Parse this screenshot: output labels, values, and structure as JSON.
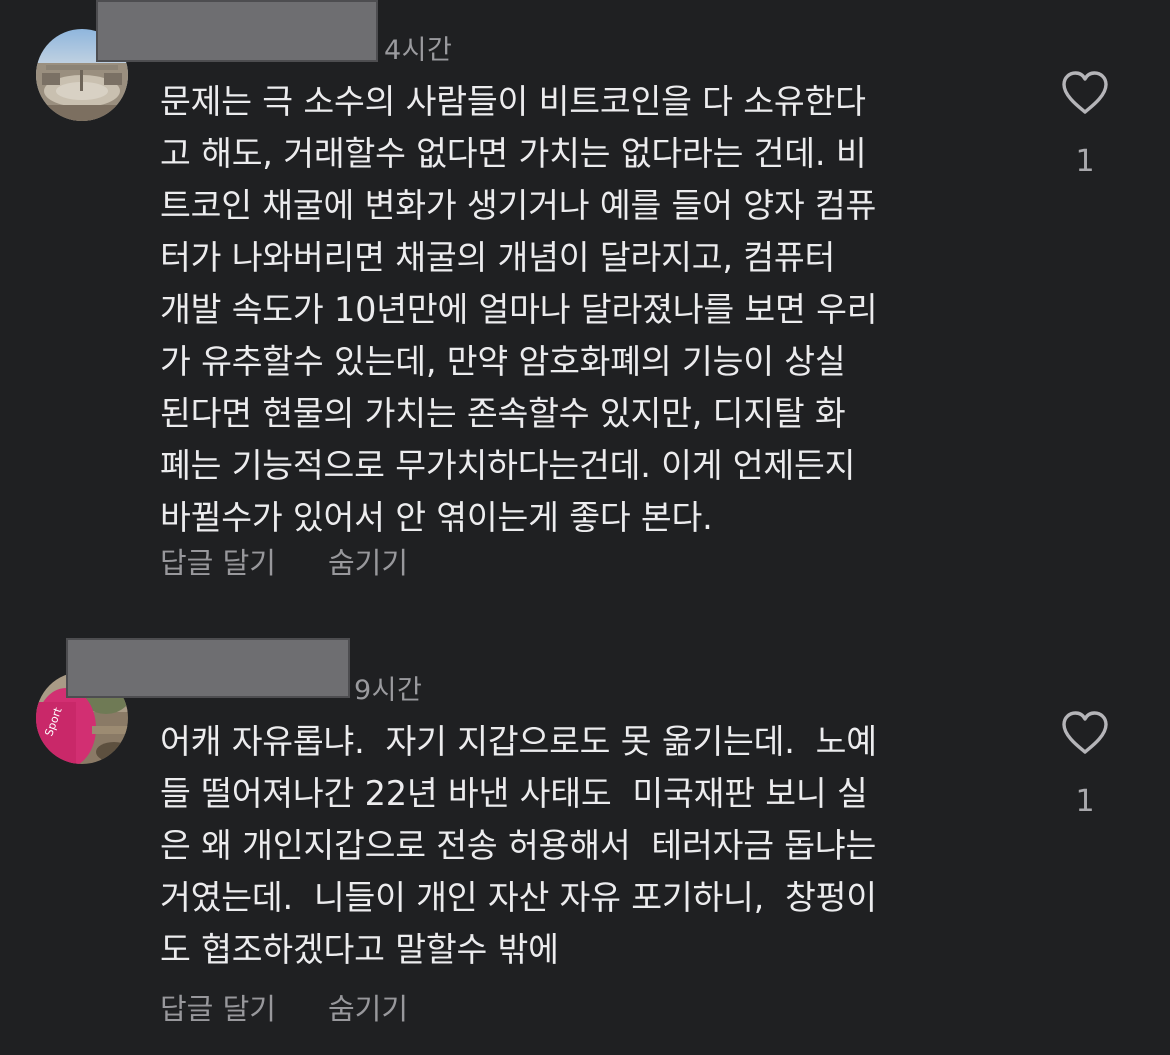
{
  "comments": [
    {
      "time": "4시간",
      "text": "문제는 극 소수의 사람들이 비트코인을 다 소유한다\n고 해도, 거래할수 없다면 가치는 없다라는 건데. 비\n트코인 채굴에 변화가 생기거나 예를 들어 양자 컴퓨\n터가 나와버리면 채굴의 개념이 달라지고, 컴퓨터\n개발 속도가 10년만에 얼마나 달라졌나를 보면 우리\n가 유추할수 있는데, 만약 암호화폐의 기능이 상실\n된다면 현물의 가치는 존속할수 있지만, 디지탈 화\n폐는 기능적으로 무가치하다는건데. 이게 언제든지\n바뀔수가 있어서 안 엮이는게 좋다 본다.",
      "reply_label": "답글 달기",
      "hide_label": "숨기기",
      "like_count": "1",
      "like_icon": "heart-outline-icon"
    },
    {
      "time": "9시간",
      "text": "어캐 자유롭냐.  자기 지갑으로도 못 옮기는데.  노예\n들 떨어져나간 22년 바낸 사태도  미국재판 보니 실\n은 왜 개인지갑으로 전송 허용해서  테러자금 돕냐는\n거였는데.  니들이 개인 자산 자유 포기하니,  창펑이\n도 협조하겠다고 말할수 밖에",
      "reply_label": "답글 달기",
      "hide_label": "숨기기",
      "like_count": "1",
      "like_icon": "heart-outline-icon"
    }
  ],
  "colors": {
    "background": "#1f2022",
    "text": "#ececee",
    "muted": "#98989c",
    "redaction": "#6e6e71"
  }
}
